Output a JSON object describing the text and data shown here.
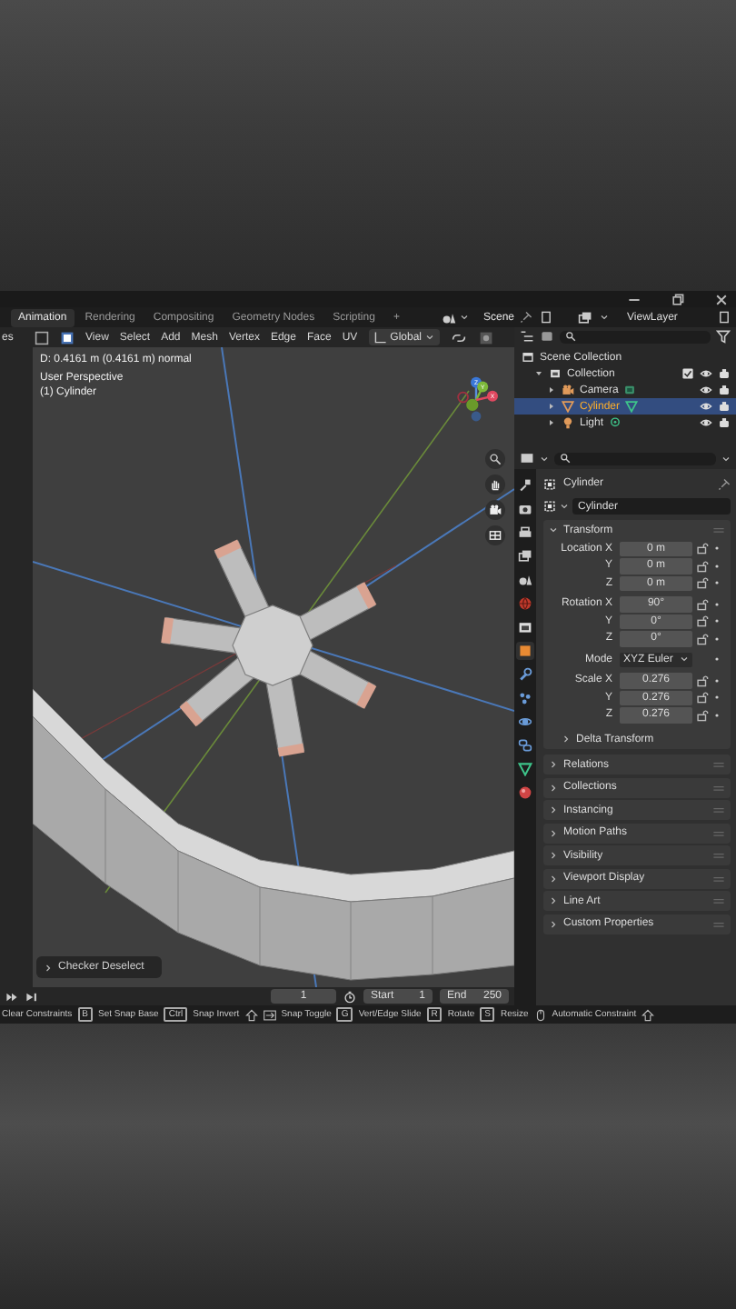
{
  "workspace_tabs": [
    {
      "label": "Animation",
      "selected": true
    },
    {
      "label": "Rendering",
      "selected": false
    },
    {
      "label": "Compositing",
      "selected": false
    },
    {
      "label": "Geometry Nodes",
      "selected": false
    },
    {
      "label": "Scripting",
      "selected": false
    }
  ],
  "add_tab": "+",
  "scene": "Scene",
  "view_layer": "ViewLayer",
  "viewport": {
    "mode_fragment": "es",
    "menus": [
      "View",
      "Select",
      "Add",
      "Mesh",
      "Vertex",
      "Edge",
      "Face",
      "UV"
    ],
    "transform_orientation": "Global",
    "operator_info": "D: 0.4161 m (0.4161 m) normal",
    "view_name": "User Perspective",
    "object_label": "(1) Cylinder",
    "gizmo_axes": [
      "Z",
      "Y",
      "X"
    ],
    "last_operator": "Checker Deselect"
  },
  "timeline": {
    "current_frame": "1",
    "start_label": "Start",
    "start": "1",
    "end_label": "End",
    "end": "250"
  },
  "outliner": {
    "items": [
      {
        "kind": "scene_collection",
        "label": "Scene Collection",
        "selected": false,
        "children": [
          {
            "kind": "collection",
            "label": "Collection",
            "selected": false,
            "expanded": true,
            "checked": true,
            "visible": true,
            "renderable": true,
            "children": [
              {
                "kind": "camera",
                "label": "Camera",
                "selected": false,
                "expanded": false,
                "visible": true,
                "renderable": true
              },
              {
                "kind": "mesh",
                "label": "Cylinder",
                "selected": true,
                "expanded": false,
                "visible": true,
                "renderable": true
              },
              {
                "kind": "light",
                "label": "Light",
                "selected": false,
                "expanded": false,
                "visible": true,
                "renderable": true
              }
            ]
          }
        ]
      }
    ]
  },
  "properties": {
    "tabs": [
      {
        "kind": "tool",
        "selected": false
      },
      {
        "kind": "render",
        "selected": false
      },
      {
        "kind": "output",
        "selected": false
      },
      {
        "kind": "view_layer",
        "selected": false
      },
      {
        "kind": "scene",
        "selected": false
      },
      {
        "kind": "world",
        "selected": false
      },
      {
        "kind": "collection",
        "selected": false
      },
      {
        "kind": "object",
        "selected": true
      },
      {
        "kind": "modifier",
        "selected": false
      },
      {
        "kind": "particles",
        "selected": false
      },
      {
        "kind": "physics",
        "selected": false
      },
      {
        "kind": "constraints",
        "selected": false
      },
      {
        "kind": "data",
        "selected": false
      },
      {
        "kind": "material",
        "selected": false
      }
    ],
    "breadcrumb": "Cylinder",
    "name_field": "Cylinder",
    "transform": {
      "title": "Transform",
      "expanded": true,
      "rows": [
        {
          "kind": "field",
          "label": "Location X",
          "value": "0 m",
          "locked": false
        },
        {
          "kind": "field",
          "label": "Y",
          "value": "0 m",
          "locked": false
        },
        {
          "kind": "field",
          "label": "Z",
          "value": "0 m",
          "locked": false
        },
        {
          "kind": "field",
          "label": "Rotation X",
          "value": "90°",
          "locked": false
        },
        {
          "kind": "field",
          "label": "Y",
          "value": "0°",
          "locked": false
        },
        {
          "kind": "field",
          "label": "Z",
          "value": "0°",
          "locked": false
        },
        {
          "kind": "dropdown",
          "label": "Mode",
          "value": "XYZ Euler"
        },
        {
          "kind": "field",
          "label": "Scale X",
          "value": "0.276",
          "locked": false
        },
        {
          "kind": "field",
          "label": "Y",
          "value": "0.276",
          "locked": false
        },
        {
          "kind": "field",
          "label": "Z",
          "value": "0.276",
          "locked": false
        }
      ],
      "subpanel": {
        "title": "Delta Transform",
        "expanded": false
      }
    },
    "panels": [
      {
        "title": "Relations",
        "expanded": false
      },
      {
        "title": "Collections",
        "expanded": false
      },
      {
        "title": "Instancing",
        "expanded": false
      },
      {
        "title": "Motion Paths",
        "expanded": false
      },
      {
        "title": "Visibility",
        "expanded": false
      },
      {
        "title": "Viewport Display",
        "expanded": false
      },
      {
        "title": "Line Art",
        "expanded": false
      },
      {
        "title": "Custom Properties",
        "expanded": false
      }
    ]
  },
  "status_bar": [
    {
      "kind": "text",
      "text": "Clear Constraints"
    },
    {
      "kind": "key",
      "text": "B"
    },
    {
      "kind": "text",
      "text": "Set Snap Base"
    },
    {
      "kind": "key",
      "text": "Ctrl"
    },
    {
      "kind": "text",
      "text": "Snap Invert"
    },
    {
      "kind": "shift"
    },
    {
      "kind": "tab"
    },
    {
      "kind": "text",
      "text": "Snap Toggle"
    },
    {
      "kind": "key",
      "text": "G"
    },
    {
      "kind": "text",
      "text": "Vert/Edge Slide"
    },
    {
      "kind": "key",
      "text": "R"
    },
    {
      "kind": "text",
      "text": "Rotate"
    },
    {
      "kind": "key",
      "text": "S"
    },
    {
      "kind": "text",
      "text": "Resize"
    },
    {
      "kind": "mouse"
    },
    {
      "kind": "text",
      "text": "Automatic Constraint"
    },
    {
      "kind": "shift"
    }
  ]
}
